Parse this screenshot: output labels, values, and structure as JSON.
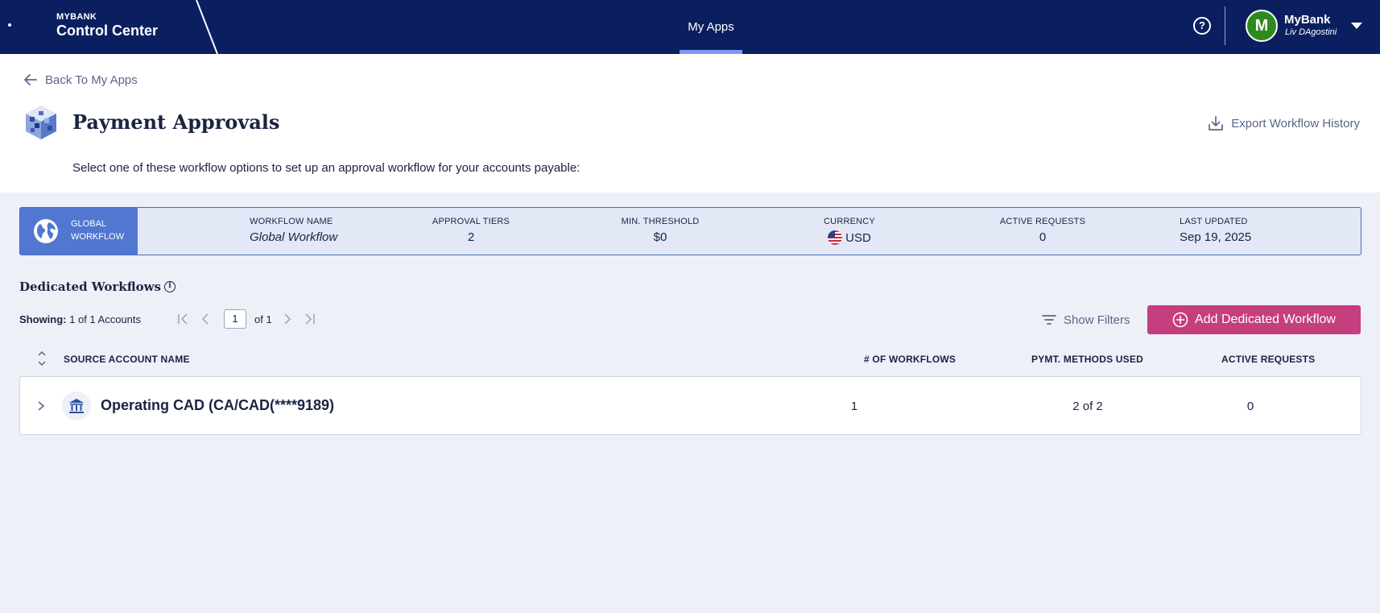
{
  "topbar": {
    "brand_small": "MYBANK",
    "brand_title": "Control Center",
    "nav_my_apps": "My Apps",
    "help_symbol": "?",
    "user_initial": "M",
    "user_name": "MyBank",
    "user_sub": "Liv DAgostini"
  },
  "header": {
    "back_label": "Back To My Apps",
    "title": "Payment Approvals",
    "export_label": "Export Workflow History",
    "subtitle": "Select one of these workflow options to set up an approval workflow for your accounts payable:"
  },
  "global_workflow": {
    "badge_line1": "GLOBAL",
    "badge_line2": "WORKFLOW",
    "columns": [
      {
        "label": "WORKFLOW NAME",
        "value": "Global Workflow"
      },
      {
        "label": "APPROVAL TIERS",
        "value": "2"
      },
      {
        "label": "MIN. THRESHOLD",
        "value": "$0"
      },
      {
        "label": "CURRENCY",
        "value": "USD"
      },
      {
        "label": "ACTIVE REQUESTS",
        "value": "0"
      },
      {
        "label": "LAST UPDATED",
        "value": "Sep 19, 2025"
      }
    ]
  },
  "dedicated": {
    "title": "Dedicated Workflows",
    "showing_label": "Showing:",
    "showing_value": "1 of 1 Accounts",
    "page_current": "1",
    "page_of": "of 1",
    "show_filters": "Show Filters",
    "add_button": "Add Dedicated Workflow",
    "table": {
      "headers": [
        "SOURCE ACCOUNT NAME",
        "# OF WORKFLOWS",
        "PYMT. METHODS USED",
        "ACTIVE REQUESTS"
      ],
      "rows": [
        {
          "account": "Operating CAD (CA/CAD(****9189)",
          "workflows": "1",
          "methods": "2 of 2",
          "active": "0"
        }
      ]
    }
  },
  "icons": {
    "back": "arrow-left-icon",
    "export": "download-icon",
    "global": "globe-icon",
    "filter": "filter-icon",
    "add": "plus-circle-icon",
    "bank": "bank-icon"
  },
  "colors": {
    "topbar": "#0b1f60",
    "accent_underline": "#7d9af5",
    "global_badge": "#5277d1",
    "add_button": "#c53e7e",
    "avatar": "#2e8a1e"
  }
}
